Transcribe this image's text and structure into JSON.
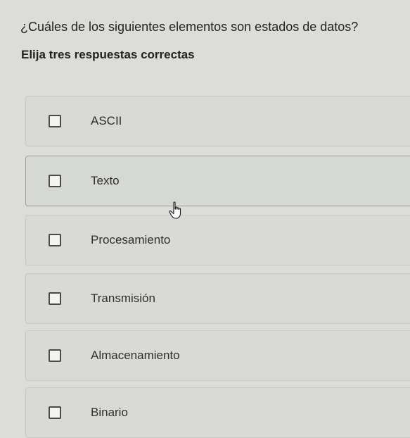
{
  "question": "¿Cuáles de los siguientes elementos son estados de datos?",
  "instruction": "Elija tres respuestas correctas",
  "options": [
    {
      "label": "ASCII",
      "checked": false
    },
    {
      "label": "Texto",
      "checked": false
    },
    {
      "label": "Procesamiento",
      "checked": false
    },
    {
      "label": "Transmisión",
      "checked": false
    },
    {
      "label": "Almacenamiento",
      "checked": false
    },
    {
      "label": "Binario",
      "checked": false
    }
  ],
  "hovered_option": "Texto",
  "cursor": "hand-pointer-icon"
}
